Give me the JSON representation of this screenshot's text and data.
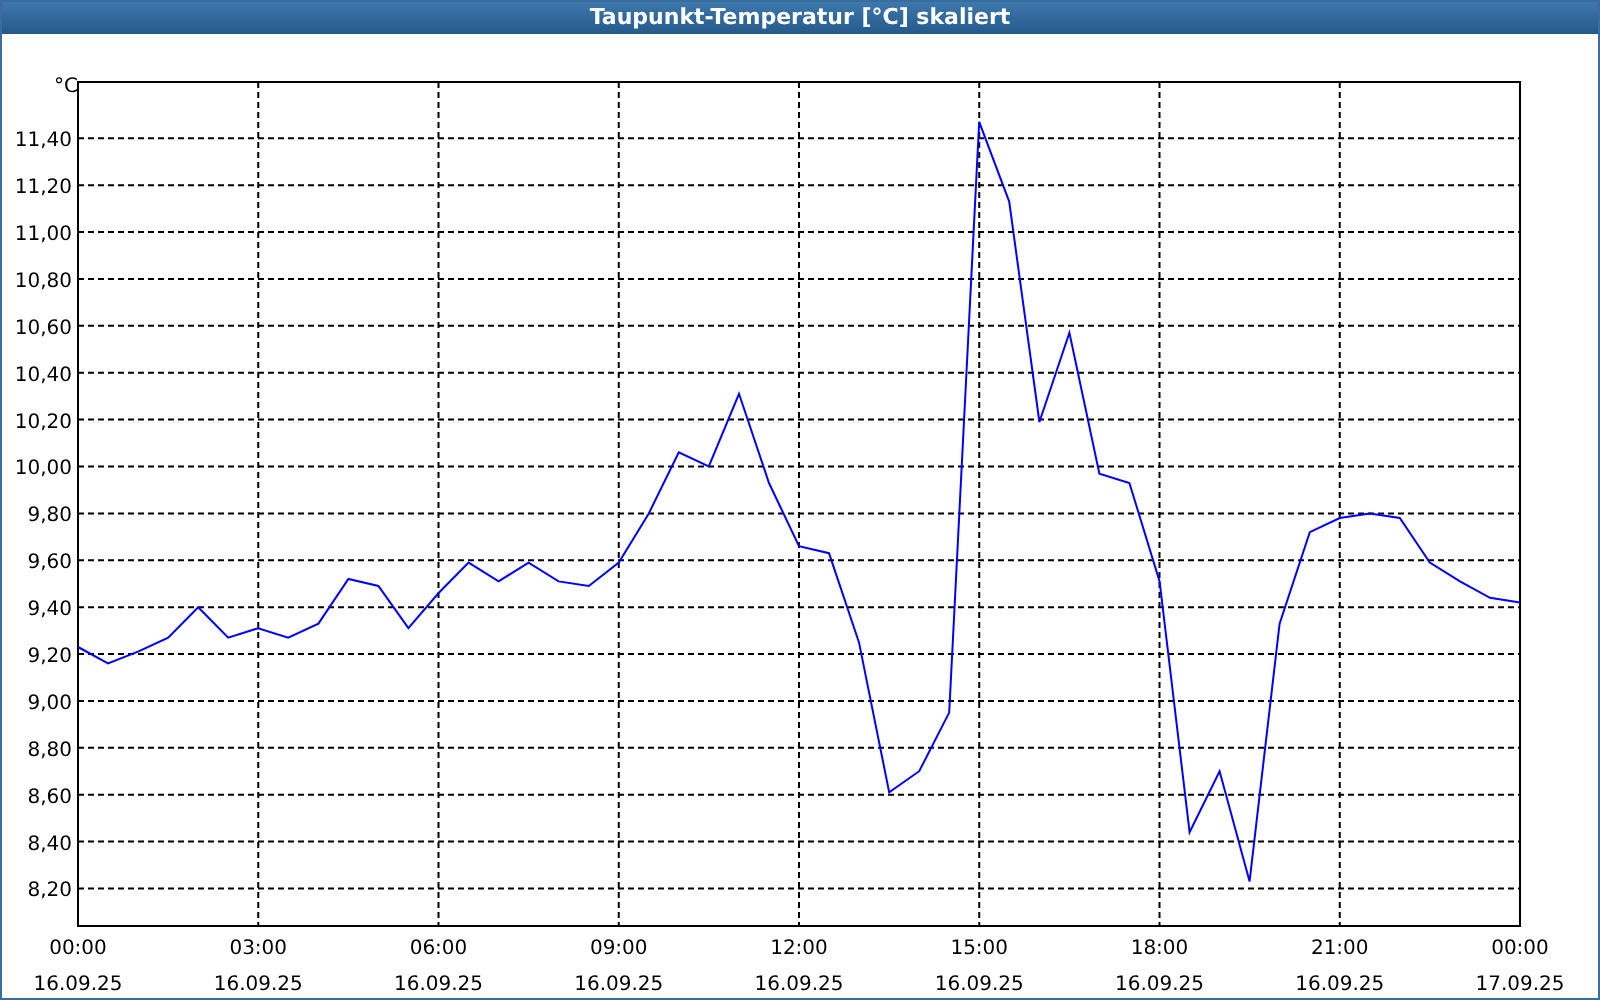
{
  "window": {
    "title": "Taupunkt-Temperatur [°C] skaliert"
  },
  "chart": {
    "chart_data": {
      "type": "line",
      "grid": true,
      "ylabel": "°C",
      "ylim": [
        8.04,
        11.64
      ],
      "categories": [
        "00:00 16.09.25",
        null,
        null,
        null,
        null,
        null,
        "03:00 16.09.25",
        null,
        null,
        null,
        null,
        null,
        "06:00 16.09.25",
        null,
        null,
        null,
        null,
        null,
        "09:00 16.09.25",
        null,
        null,
        null,
        null,
        null,
        "12:00 16.09.25",
        null,
        null,
        null,
        null,
        null,
        "15:00 16.09.25",
        null,
        null,
        null,
        null,
        null,
        "18:00 16.09.25",
        null,
        null,
        null,
        null,
        null,
        "21:00 16.09.25",
        null,
        null,
        null,
        null,
        null,
        "00:00 17.09.25"
      ],
      "yticks": [
        {
          "value": 8.2,
          "label": "8,20"
        },
        {
          "value": 8.4,
          "label": "8,40"
        },
        {
          "value": 8.6,
          "label": "8,60"
        },
        {
          "value": 8.8,
          "label": "8,80"
        },
        {
          "value": 9.0,
          "label": "9,00"
        },
        {
          "value": 9.2,
          "label": "9,20"
        },
        {
          "value": 9.4,
          "label": "9,40"
        },
        {
          "value": 9.6,
          "label": "9,60"
        },
        {
          "value": 9.8,
          "label": "9,80"
        },
        {
          "value": 10.0,
          "label": "10,00"
        },
        {
          "value": 10.2,
          "label": "10,20"
        },
        {
          "value": 10.4,
          "label": "10,40"
        },
        {
          "value": 10.6,
          "label": "10,60"
        },
        {
          "value": 10.8,
          "label": "10,80"
        },
        {
          "value": 11.0,
          "label": "11,00"
        },
        {
          "value": 11.2,
          "label": "11,20"
        },
        {
          "value": 11.4,
          "label": "11,40"
        }
      ],
      "series": [
        {
          "color": "#0000ff",
          "values": [
            9.23,
            9.16,
            9.21,
            9.27,
            9.4,
            9.27,
            9.31,
            9.27,
            9.33,
            9.52,
            9.49,
            9.31,
            9.46,
            9.59,
            9.51,
            9.59,
            9.51,
            9.49,
            9.59,
            9.8,
            10.06,
            10.0,
            10.31,
            9.93,
            9.66,
            9.63,
            9.25,
            8.61,
            8.7,
            8.95,
            11.47,
            11.13,
            10.19,
            10.57,
            9.97,
            9.93,
            9.51,
            8.44,
            8.7,
            8.23,
            9.33,
            9.72,
            9.78,
            9.8,
            9.78,
            9.59,
            9.51,
            9.44,
            9.42
          ]
        }
      ]
    }
  }
}
